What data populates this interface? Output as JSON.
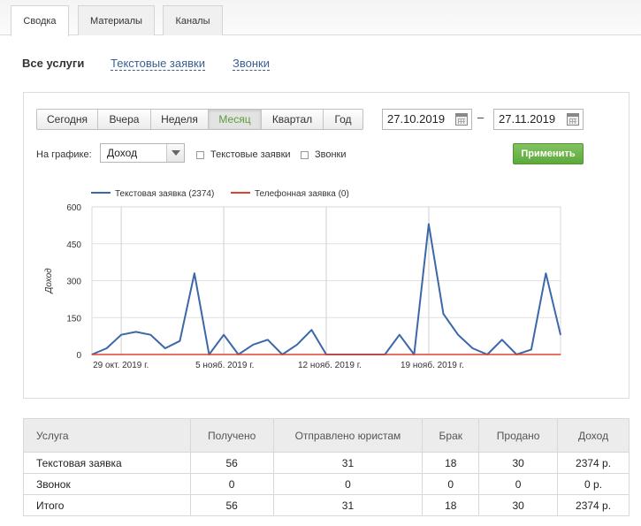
{
  "tabs": [
    {
      "label": "Сводка",
      "active": true
    },
    {
      "label": "Материалы",
      "active": false
    },
    {
      "label": "Каналы",
      "active": false
    }
  ],
  "subnav": {
    "current": "Все услуги",
    "links": [
      "Текстовые заявки",
      "Звонки"
    ]
  },
  "filters": {
    "periods": [
      "Сегодня",
      "Вчера",
      "Неделя",
      "Месяц",
      "Квартал",
      "Год"
    ],
    "selected_period": "Месяц",
    "date_from": "27.10.2019",
    "date_to": "27.11.2019",
    "range_separator": "–",
    "on_graph_label": "На графике:",
    "on_graph_value": "Доход",
    "checkboxes": [
      {
        "label": "Текстовые заявки",
        "checked": false
      },
      {
        "label": "Звонки",
        "checked": false
      }
    ],
    "apply_label": "Применить"
  },
  "chart_data": {
    "type": "line",
    "ylabel": "Доход",
    "ylim": [
      0,
      600
    ],
    "yticks": [
      0,
      150,
      300,
      450,
      600
    ],
    "x_labels": [
      "29 окт. 2019 г.",
      "5 нояб. 2019 г.",
      "12 нояб. 2019 г.",
      "19 нояб. 2019 г."
    ],
    "x_label_index": [
      2,
      9,
      16,
      23
    ],
    "x_count": 32,
    "legend_position": "top-left",
    "series": [
      {
        "name": "Текстовая заявка (2374)",
        "color": "#3c67a8",
        "values": [
          0,
          25,
          80,
          92,
          80,
          25,
          55,
          330,
          0,
          80,
          0,
          40,
          60,
          0,
          40,
          100,
          0,
          0,
          0,
          0,
          0,
          80,
          0,
          530,
          165,
          80,
          25,
          0,
          60,
          0,
          20,
          330,
          80
        ]
      },
      {
        "name": "Телефонная заявка (0)",
        "color": "#e0432d",
        "values": [
          0,
          0,
          0,
          0,
          0,
          0,
          0,
          0,
          0,
          0,
          0,
          0,
          0,
          0,
          0,
          0,
          0,
          0,
          0,
          0,
          0,
          0,
          0,
          0,
          0,
          0,
          0,
          0,
          0,
          0,
          0,
          0,
          0
        ]
      }
    ]
  },
  "table": {
    "headers": [
      "Услуга",
      "Получено",
      "Отправлено юристам",
      "Брак",
      "Продано",
      "Доход"
    ],
    "rows": [
      [
        "Текстовая заявка",
        "56",
        "31",
        "18",
        "30",
        "2374 р."
      ],
      [
        "Звонок",
        "0",
        "0",
        "0",
        "0",
        "0 р."
      ],
      [
        "Итого",
        "56",
        "31",
        "18",
        "30",
        "2374 р."
      ]
    ]
  }
}
